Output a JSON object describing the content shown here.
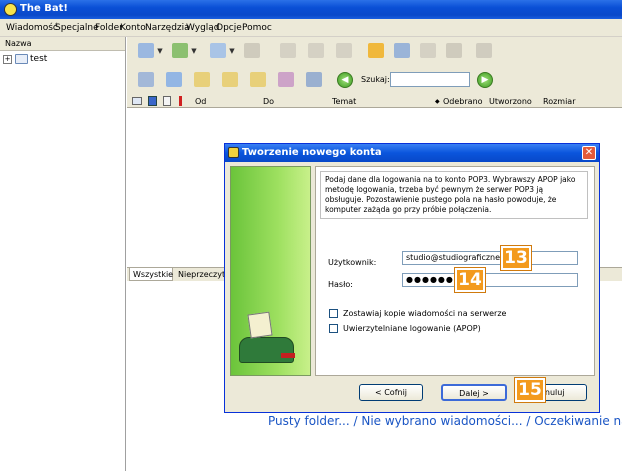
{
  "window": {
    "title": "The Bat!"
  },
  "menu": [
    "Wiadomość",
    "Specjalne",
    "Folder",
    "Konto",
    "Narzędzia",
    "Wygląd",
    "Opcje",
    "Pomoc"
  ],
  "search": {
    "label": "Szukaj:",
    "value": ""
  },
  "folders": {
    "header": "Nazwa",
    "items": [
      {
        "name": "test"
      }
    ]
  },
  "list": {
    "columns": [
      "Od",
      "Do",
      "Temat",
      "Odebrano",
      "Utworzono",
      "Rozmiar"
    ]
  },
  "tabs": [
    "Wszystkie",
    "Nieprzeczytan"
  ],
  "dialog": {
    "title": "Tworzenie nowego konta",
    "info": "Podaj dane dla logowania na to konto POP3. Wybrawszy APOP jako metodę logowania, trzeba być pewnym że serwer POP3 ją obsługuje. Pozostawienie pustego pola na hasło powoduje, że komputer zażąda go przy próbie połączenia.",
    "user_label": "Użytkownik:",
    "user_value": "studio@studiograficzne.com",
    "pass_label": "Hasło:",
    "pass_value": "●●●●●●●●●",
    "keep_copies_label": "Zostawiaj kopie wiadomości na serwerze",
    "apop_label": "Uwierzytelniane logowanie (APOP)",
    "keep_copies_checked": false,
    "apop_checked": false,
    "back_label": "< Cofnij",
    "next_label": "Dalej >",
    "cancel_label": "Anuluj"
  },
  "annotations": {
    "badge_user": "13",
    "badge_pass": "14",
    "badge_next": "15"
  },
  "status_text": "Pusty folder... / Nie wybrano wiadomości... / Oczekiwanie na w",
  "colors": {
    "title_blue": "#0a4fd6",
    "badge_orange": "#f39a1d",
    "status_blue": "#1a55c4"
  }
}
